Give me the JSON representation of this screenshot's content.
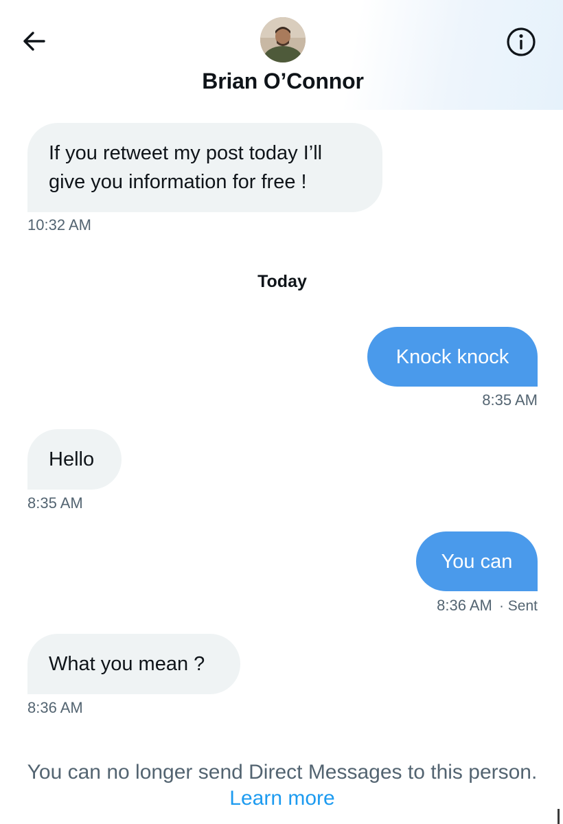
{
  "header": {
    "back_icon": "arrow-left-icon",
    "info_icon": "info-circle-icon",
    "contact_name": "Brian O’Connor"
  },
  "messages": [
    {
      "direction": "incoming",
      "text_line1": "If you retweet my post today I’ll",
      "text_line2": "give you information for free !",
      "time": "10:32 AM"
    },
    {
      "direction": "separator",
      "text": "Today"
    },
    {
      "direction": "outgoing",
      "text": "Knock knock",
      "time": "8:35 AM"
    },
    {
      "direction": "incoming",
      "text": "Hello",
      "time": "8:35 AM"
    },
    {
      "direction": "outgoing",
      "text": "You can",
      "time": "8:36 AM",
      "status": "· Sent"
    },
    {
      "direction": "incoming",
      "text": "What you mean ?",
      "time": "8:36 AM"
    }
  ],
  "footer": {
    "notice": "You can no longer send Direct Messages to this person.",
    "link": "Learn more"
  },
  "colors": {
    "outgoing_bubble": "#4a9aeb",
    "incoming_bubble": "#eff3f4",
    "timestamp": "#536471",
    "link": "#1d9bf0"
  }
}
